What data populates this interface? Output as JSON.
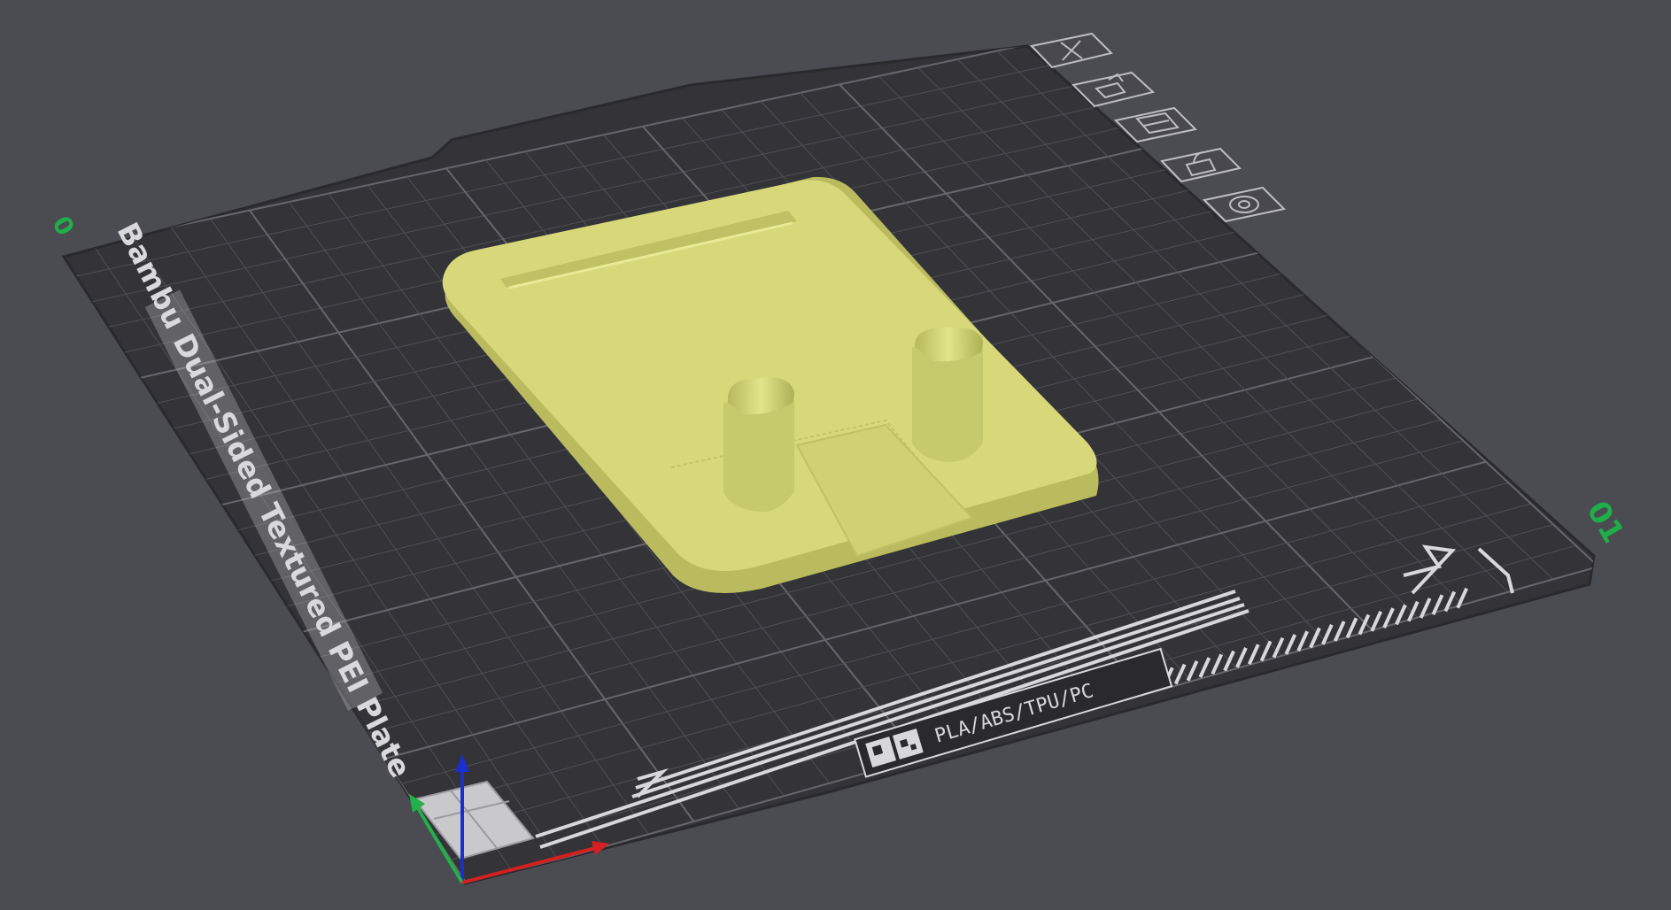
{
  "scene": {
    "plate_name": "Bambu Dual-Sided Textured PEI Plate",
    "filament_types": "PLA/ABS/TPU/PC",
    "plate_index_label": "01",
    "corner_marker": "0"
  },
  "toolbar": {
    "delete_plate": "delete-plate",
    "auto_arrange": "auto-arrange",
    "plate_settings": "plate-settings",
    "lock_plate": "lock-plate",
    "plate_options": "plate-options"
  },
  "colors": {
    "background": "#4b4b52",
    "plate": "#333338",
    "plate_grid": "#55555a",
    "model_top": "#d6d87a",
    "model_side": "#b9bb5e",
    "axis_x": "#d42020",
    "axis_y": "#22b04a",
    "axis_z": "#1a2fd0",
    "index_label": "#1fae4a"
  }
}
